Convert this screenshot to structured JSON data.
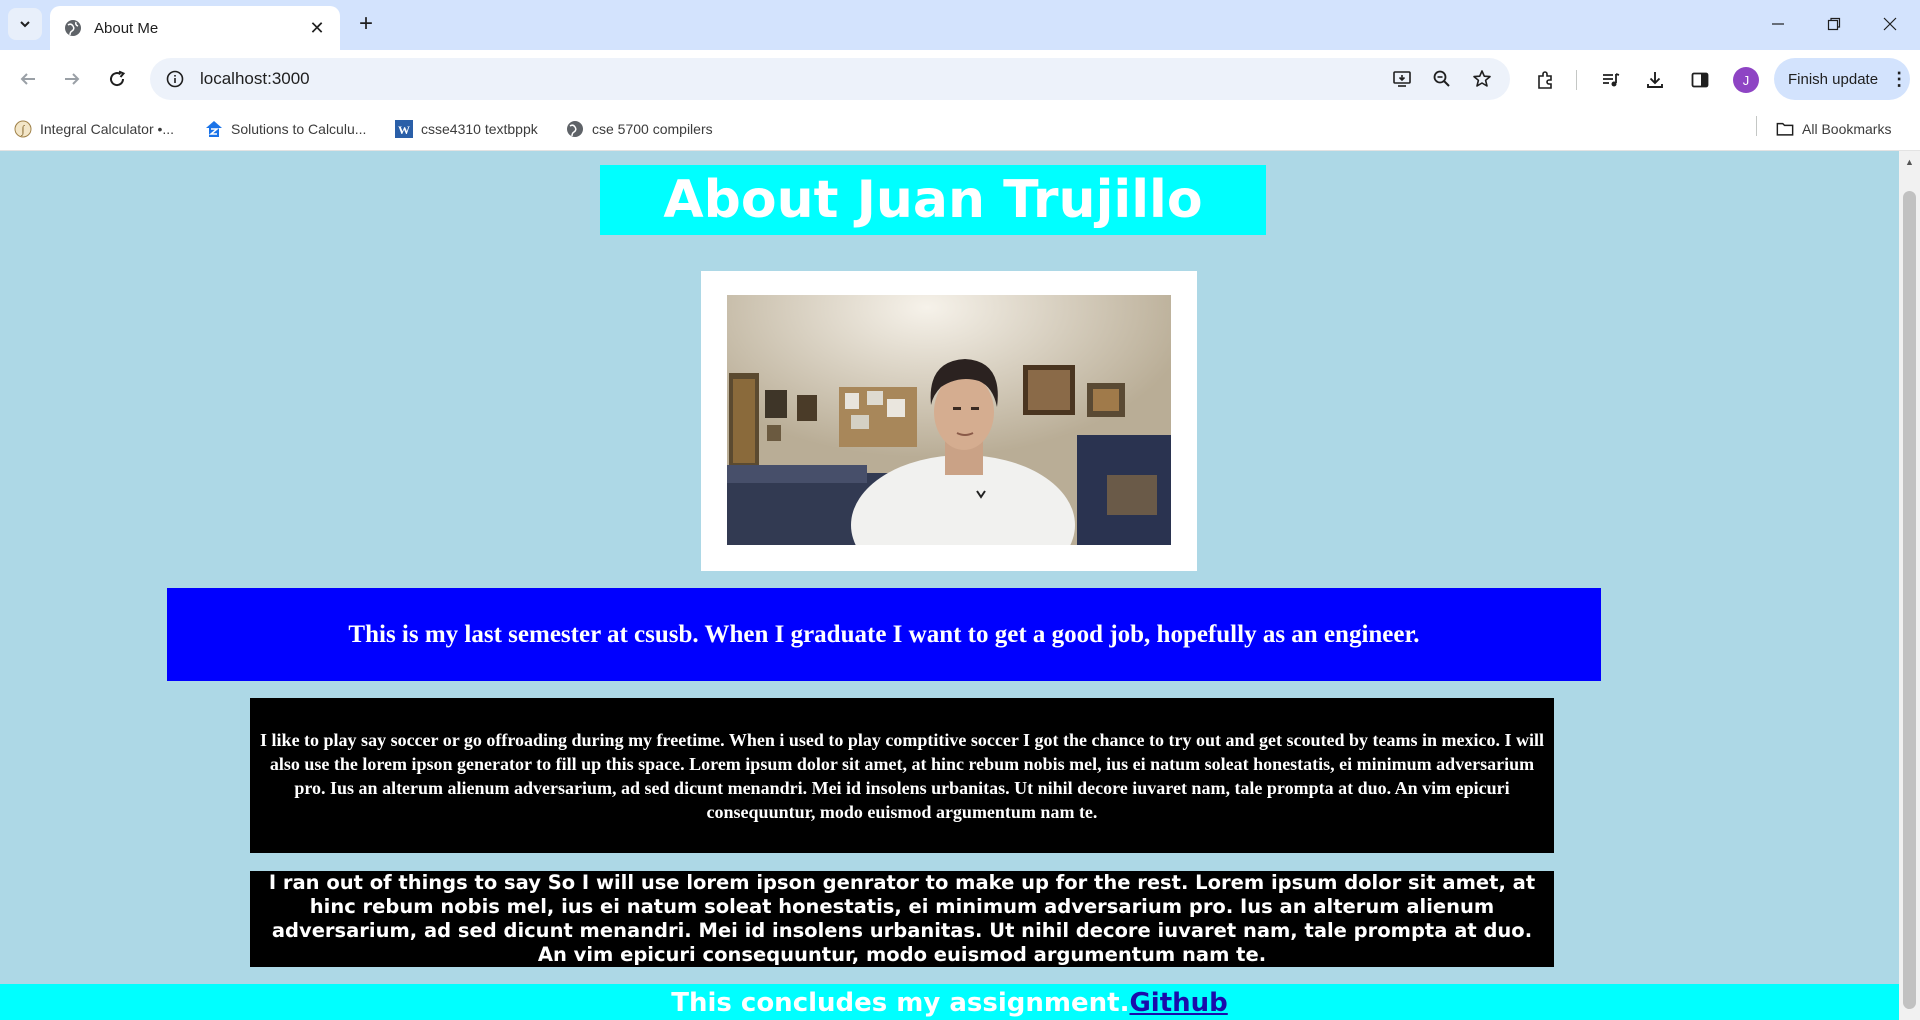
{
  "browser": {
    "tab_title": "About Me",
    "url": "localhost:3000",
    "update_label": "Finish update",
    "avatar_letter": "J",
    "bookmarks": [
      {
        "label": "Integral Calculator •...",
        "icon": "integral-calculator-favicon"
      },
      {
        "label": "Solutions to Calculu...",
        "icon": "solutions-favicon"
      },
      {
        "label": "csse4310 textbppk",
        "icon": "wordpress-favicon"
      },
      {
        "label": "cse 5700 compilers",
        "icon": "globe-favicon"
      }
    ],
    "all_bookmarks_label": "All Bookmarks"
  },
  "page": {
    "heading": "About Juan Trujillo",
    "photo_alt": "photo of Juan Trujillo",
    "intro": "This is my last semester at csusb. When I graduate I want to get a good job, hopefully as an engineer.",
    "paragraph1": "I like to play say soccer or go offroading during my freetime. When i used to play comptitive soccer I got the chance to try out and get scouted by teams in mexico. I will also use the lorem ipson generator to fill up this space. Lorem ipsum dolor sit amet, at hinc rebum nobis mel, ius ei natum soleat honestatis, ei minimum adversarium pro. Ius an alterum alienum adversarium, ad sed dicunt menandri. Mei id insolens urbanitas. Ut nihil decore iuvaret nam, tale prompta at duo. An vim epicuri consequuntur, modo euismod argumentum nam te.",
    "paragraph2": "I ran out of things to say So I will use lorem ipson genrator to make up for the rest. Lorem ipsum dolor sit amet, at hinc rebum nobis mel, ius ei natum soleat honestatis, ei minimum adversarium pro. Ius an alterum alienum adversarium, ad sed dicunt menandri. Mei id insolens urbanitas. Ut nihil decore iuvaret nam, tale prompta at duo. An vim epicuri consequuntur, modo euismod argumentum nam te.",
    "footer_text": "This concludes my assignment.",
    "footer_link": "Github"
  },
  "colors": {
    "page_bg": "#add8e6",
    "heading_bg": "#00ffff",
    "intro_bg": "#0000ff",
    "paragraph_bg": "#000000",
    "footer_bg": "#00ffff"
  }
}
